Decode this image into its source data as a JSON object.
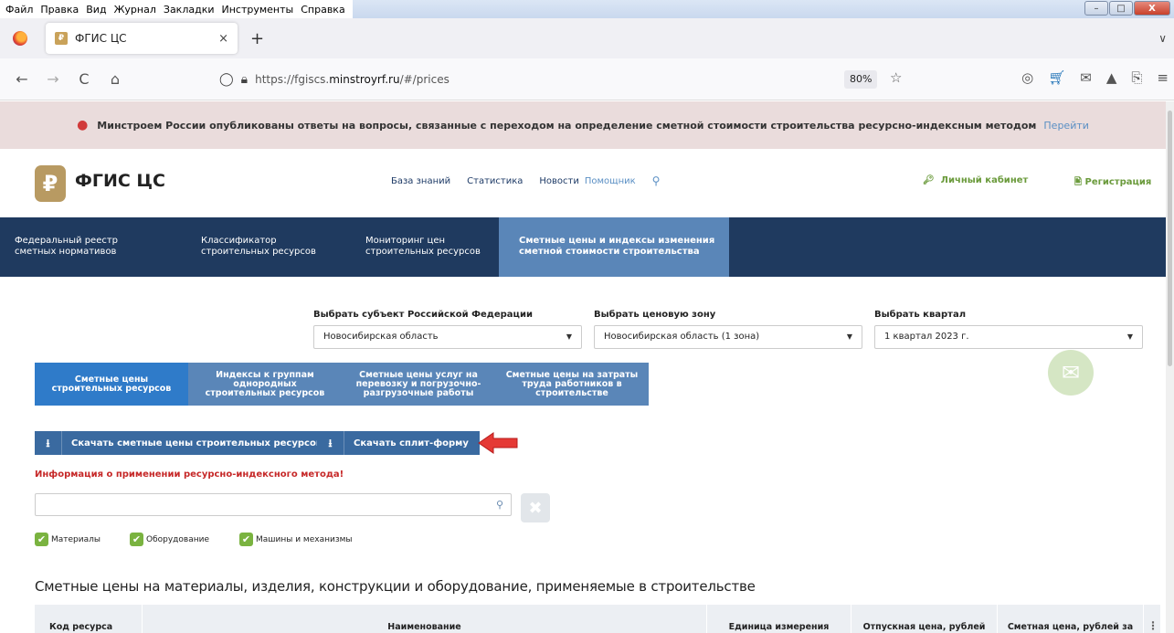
{
  "browser": {
    "menu": [
      "Файл",
      "Правка",
      "Вид",
      "Журнал",
      "Закладки",
      "Инструменты",
      "Справка"
    ],
    "tab_title": "ФГИС ЦС",
    "favicon_text": "₽",
    "close_glyph": "×",
    "newtab_glyph": "+",
    "url_prefix": "https://fgiscs.",
    "url_domain": "minstroyrf.ru",
    "url_suffix": "/#/prices",
    "zoom": "80%"
  },
  "notice": {
    "text": "Минстроем России опубликованы ответы на вопросы, связанные с переходом на определение сметной стоимости строительства ресурсно-индексным методом",
    "link": "Перейти"
  },
  "header": {
    "logo_glyph": "₽",
    "brand": "ФГИС ЦС",
    "nav": [
      "База знаний",
      "Статистика",
      "Новости",
      "Помощник"
    ],
    "cabinet": "Личный кабинет",
    "register": "Регистрация"
  },
  "main_nav": [
    "Федеральный реестр\nсметных нормативов",
    "Классификатор\nстроительных ресурсов",
    "Мониторинг цен\nстроительных ресурсов",
    "Сметные цены и индексы изменения\nсметной стоимости строительства"
  ],
  "selectors": {
    "subject_label": "Выбрать субъект Российской Федерации",
    "subject_value": "Новосибирская область",
    "zone_label": "Выбрать ценовую зону",
    "zone_value": "Новосибирская область (1 зона)",
    "quarter_label": "Выбрать квартал",
    "quarter_value": "1 квартал 2023 г."
  },
  "sub_tabs": [
    "Сметные цены\nстроительных ресурсов",
    "Индексы к группам\nоднородных\nстроительных ресурсов",
    "Сметные цены услуг на\nперевозку и погрузочно-\nразгрузочные работы",
    "Сметные цены на затраты\nтруда работников в\nстроительстве"
  ],
  "buttons": {
    "download_prices": "Скачать сметные цены строительных ресурсов",
    "download_split": "Скачать сплит-форму"
  },
  "info_link": "Информация о применении ресурсно-индексного метода!",
  "filters": [
    "Материалы",
    "Оборудование",
    "Машины и механизмы"
  ],
  "section_title": "Сметные цены на материалы, изделия, конструкции и оборудование, применяемые в строительстве",
  "table": {
    "columns": [
      "Код ресурса",
      "Наименование",
      "Единица измерения",
      "Отпускная цена, рублей",
      "Сметная цена, рублей за"
    ]
  },
  "colors": {
    "nav_dark": "#1f3a5f",
    "nav_active": "#5a86b8",
    "accent_green": "#7ab340",
    "alert_red": "#c62828",
    "arrow_red": "#e53935"
  },
  "icons": {
    "back": "←",
    "forward": "→",
    "reload": "C",
    "home": "⌂",
    "shield": "◯",
    "lock": "🔒",
    "star": "☆",
    "pocket": "◎",
    "cart": "🛒",
    "mail": "✉",
    "drive": "▲",
    "share": "⎘",
    "menu": "≡",
    "search": "⚲",
    "download": "⭳",
    "clear": "✖",
    "check": "✔",
    "key": "🔑",
    "register": "🖹"
  }
}
